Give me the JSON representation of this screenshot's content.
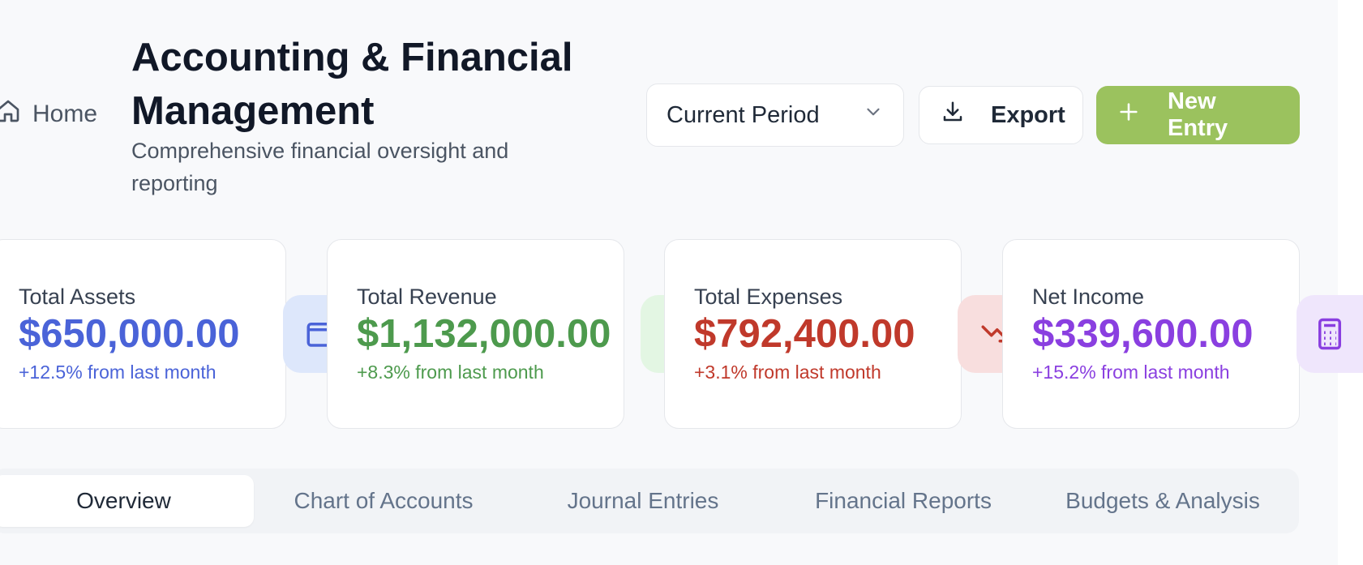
{
  "header": {
    "home_label": "Home",
    "title": "Accounting & Financial Management",
    "subtitle": "Comprehensive financial oversight and reporting"
  },
  "toolbar": {
    "period_label": "Current Period",
    "export_label": "Export",
    "new_entry_label": "New Entry"
  },
  "stats": [
    {
      "label": "Total Assets",
      "value": "$650,000.00",
      "change": "+12.5% from last month",
      "color": "#4a63d8",
      "icon": "wallet-icon",
      "icon_bg": "#dde7fb"
    },
    {
      "label": "Total Revenue",
      "value": "$1,132,000.00",
      "change": "+8.3% from last month",
      "color": "#4d9a4d",
      "icon": "trending-up-icon",
      "icon_bg": "#e3f6e3"
    },
    {
      "label": "Total Expenses",
      "value": "$792,400.00",
      "change": "+3.1% from last month",
      "color": "#c0392b",
      "icon": "trending-down-icon",
      "icon_bg": "#f8dede"
    },
    {
      "label": "Net Income",
      "value": "$339,600.00",
      "change": "+15.2% from last month",
      "color": "#8a3fe0",
      "icon": "calculator-icon",
      "icon_bg": "#efe6fc"
    }
  ],
  "tabs": [
    {
      "label": "Overview",
      "active": true
    },
    {
      "label": "Chart of Accounts",
      "active": false
    },
    {
      "label": "Journal Entries",
      "active": false
    },
    {
      "label": "Financial Reports",
      "active": false
    },
    {
      "label": "Budgets & Analysis",
      "active": false
    }
  ]
}
